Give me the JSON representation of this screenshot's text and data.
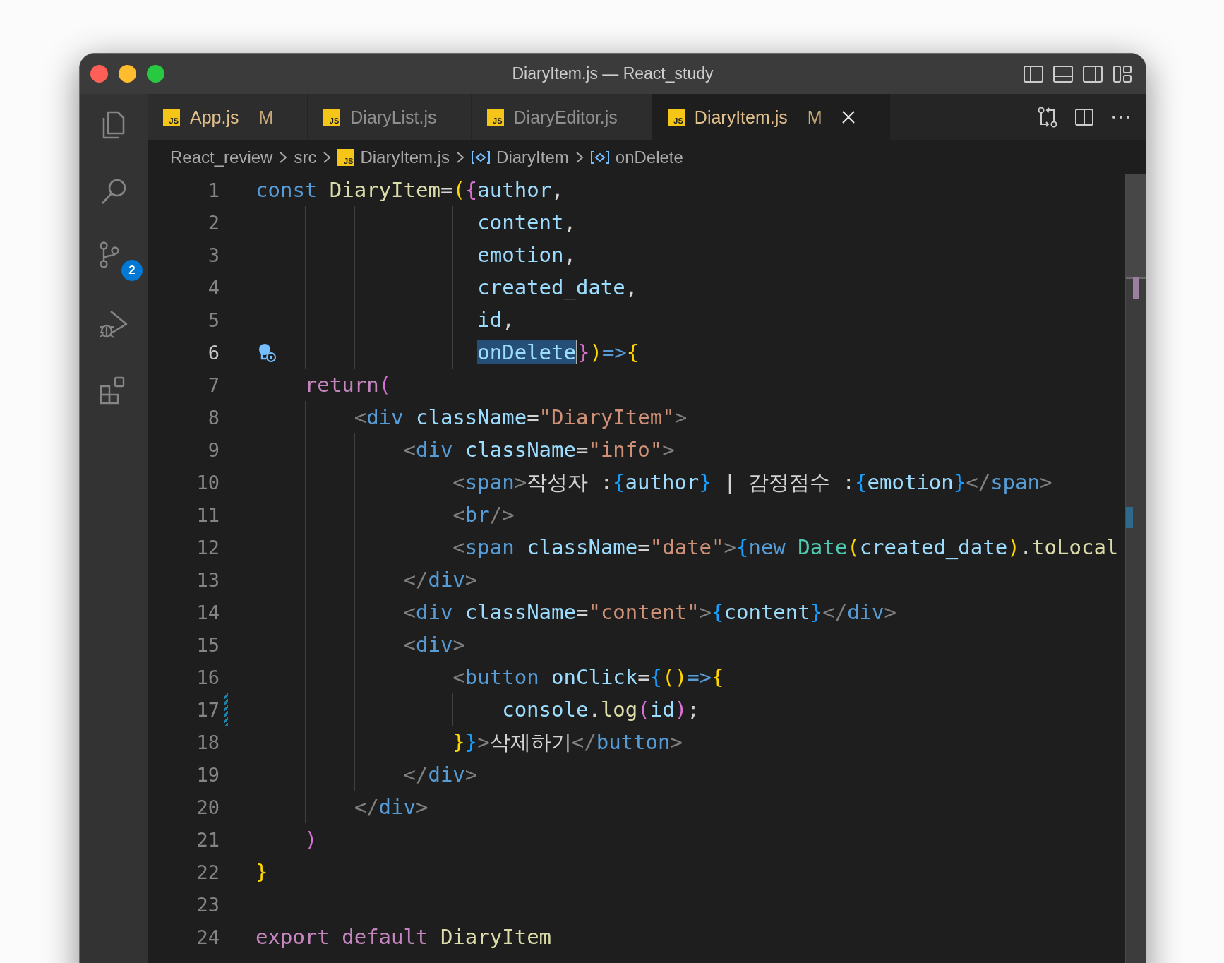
{
  "window": {
    "title": "DiaryItem.js — React_study"
  },
  "activity_bar": [
    {
      "kind": "explorer"
    },
    {
      "kind": "search"
    },
    {
      "kind": "source-control",
      "badge": "2"
    },
    {
      "kind": "run-debug"
    },
    {
      "kind": "extensions"
    }
  ],
  "tabs": [
    {
      "label": "App.js",
      "file_icon": "JS",
      "status": "M",
      "selected": false
    },
    {
      "label": "DiaryList.js",
      "file_icon": "JS",
      "selected": false
    },
    {
      "label": "DiaryEditor.js",
      "file_icon": "JS",
      "selected": false
    },
    {
      "label": "DiaryItem.js",
      "file_icon": "JS",
      "status": "M",
      "selected": true
    }
  ],
  "breadcrumb": [
    {
      "label": "React_review",
      "kind": "folder"
    },
    {
      "label": "src",
      "kind": "folder"
    },
    {
      "label": "DiaryItem.js",
      "kind": "file",
      "file_icon": "JS"
    },
    {
      "label": "DiaryItem",
      "kind": "symbol"
    },
    {
      "label": "onDelete",
      "kind": "symbol"
    }
  ],
  "lines": [
    {
      "num": "1",
      "active": false,
      "lightbulb": false,
      "modified": false,
      "tokens": [
        {
          "text": "const",
          "kind": "keyword"
        },
        {
          "text": " DiaryItem",
          "kind": "function"
        },
        {
          "text": "=",
          "kind": "punct"
        },
        {
          "text": "(",
          "kind": "bracket1"
        },
        {
          "text": "{",
          "kind": "bracket2"
        },
        {
          "text": "author",
          "kind": "variable"
        },
        {
          "text": ",",
          "kind": "punct"
        }
      ]
    },
    {
      "num": "2",
      "active": false,
      "lightbulb": false,
      "modified": false,
      "tokens": [
        {
          "text": "                  content",
          "kind": "variable"
        },
        {
          "text": ",",
          "kind": "punct"
        }
      ]
    },
    {
      "num": "3",
      "active": false,
      "lightbulb": false,
      "modified": false,
      "tokens": [
        {
          "text": "                  emotion",
          "kind": "variable"
        },
        {
          "text": ",",
          "kind": "punct"
        }
      ]
    },
    {
      "num": "4",
      "active": false,
      "lightbulb": false,
      "modified": false,
      "tokens": [
        {
          "text": "                  created_date",
          "kind": "variable"
        },
        {
          "text": ",",
          "kind": "punct"
        }
      ]
    },
    {
      "num": "5",
      "active": false,
      "lightbulb": false,
      "modified": false,
      "tokens": [
        {
          "text": "                  id",
          "kind": "variable"
        },
        {
          "text": ",",
          "kind": "punct"
        }
      ]
    },
    {
      "num": "6",
      "active": true,
      "lightbulb": true,
      "modified": false,
      "tokens": [
        {
          "text": "                  onDelete",
          "kind": "selection"
        },
        {
          "text": "}",
          "kind": "bracket2"
        },
        {
          "text": ")",
          "kind": "bracket1"
        },
        {
          "text": "=>",
          "kind": "keyword"
        },
        {
          "text": "{",
          "kind": "bracket1"
        }
      ]
    },
    {
      "num": "7",
      "active": false,
      "lightbulb": false,
      "modified": false,
      "tokens": [
        {
          "text": "    return",
          "kind": "control"
        },
        {
          "text": "(",
          "kind": "bracket2"
        }
      ]
    },
    {
      "num": "8",
      "active": false,
      "lightbulb": false,
      "modified": false,
      "tokens": [
        {
          "text": "        <",
          "kind": "angle"
        },
        {
          "text": "div",
          "kind": "tag"
        },
        {
          "text": " className",
          "kind": "attribute"
        },
        {
          "text": "=",
          "kind": "punct"
        },
        {
          "text": "\"DiaryItem\"",
          "kind": "string"
        },
        {
          "text": ">",
          "kind": "angle"
        }
      ]
    },
    {
      "num": "9",
      "active": false,
      "lightbulb": false,
      "modified": false,
      "tokens": [
        {
          "text": "            <",
          "kind": "angle"
        },
        {
          "text": "div",
          "kind": "tag"
        },
        {
          "text": " className",
          "kind": "attribute"
        },
        {
          "text": "=",
          "kind": "punct"
        },
        {
          "text": "\"info\"",
          "kind": "string"
        },
        {
          "text": ">",
          "kind": "angle"
        }
      ]
    },
    {
      "num": "10",
      "active": false,
      "lightbulb": false,
      "modified": false,
      "tokens": [
        {
          "text": "                <",
          "kind": "angle"
        },
        {
          "text": "span",
          "kind": "tag"
        },
        {
          "text": ">",
          "kind": "angle"
        },
        {
          "text": "작성자 :",
          "kind": "text"
        },
        {
          "text": "{",
          "kind": "bracket3"
        },
        {
          "text": "author",
          "kind": "variable"
        },
        {
          "text": "}",
          "kind": "bracket3"
        },
        {
          "text": " | 감정점수 :",
          "kind": "text"
        },
        {
          "text": "{",
          "kind": "bracket3"
        },
        {
          "text": "emotion",
          "kind": "variable"
        },
        {
          "text": "}",
          "kind": "bracket3"
        },
        {
          "text": "</",
          "kind": "angle"
        },
        {
          "text": "span",
          "kind": "tag"
        },
        {
          "text": ">",
          "kind": "angle"
        }
      ]
    },
    {
      "num": "11",
      "active": false,
      "lightbulb": false,
      "modified": false,
      "tokens": [
        {
          "text": "                <",
          "kind": "angle"
        },
        {
          "text": "br",
          "kind": "tag"
        },
        {
          "text": "/>",
          "kind": "angle"
        }
      ]
    },
    {
      "num": "12",
      "active": false,
      "lightbulb": false,
      "modified": false,
      "tokens": [
        {
          "text": "                <",
          "kind": "angle"
        },
        {
          "text": "span",
          "kind": "tag"
        },
        {
          "text": " className",
          "kind": "attribute"
        },
        {
          "text": "=",
          "kind": "punct"
        },
        {
          "text": "\"date\"",
          "kind": "string"
        },
        {
          "text": ">",
          "kind": "angle"
        },
        {
          "text": "{",
          "kind": "bracket3"
        },
        {
          "text": "new",
          "kind": "keyword"
        },
        {
          "text": " Date",
          "kind": "class"
        },
        {
          "text": "(",
          "kind": "bracket1"
        },
        {
          "text": "created_date",
          "kind": "variable"
        },
        {
          "text": ")",
          "kind": "bracket1"
        },
        {
          "text": ".",
          "kind": "punct"
        },
        {
          "text": "toLocal",
          "kind": "function"
        }
      ]
    },
    {
      "num": "13",
      "active": false,
      "lightbulb": false,
      "modified": false,
      "tokens": [
        {
          "text": "            </",
          "kind": "angle"
        },
        {
          "text": "div",
          "kind": "tag"
        },
        {
          "text": ">",
          "kind": "angle"
        }
      ]
    },
    {
      "num": "14",
      "active": false,
      "lightbulb": false,
      "modified": false,
      "tokens": [
        {
          "text": "            <",
          "kind": "angle"
        },
        {
          "text": "div",
          "kind": "tag"
        },
        {
          "text": " className",
          "kind": "attribute"
        },
        {
          "text": "=",
          "kind": "punct"
        },
        {
          "text": "\"content\"",
          "kind": "string"
        },
        {
          "text": ">",
          "kind": "angle"
        },
        {
          "text": "{",
          "kind": "bracket3"
        },
        {
          "text": "content",
          "kind": "variable"
        },
        {
          "text": "}",
          "kind": "bracket3"
        },
        {
          "text": "</",
          "kind": "angle"
        },
        {
          "text": "div",
          "kind": "tag"
        },
        {
          "text": ">",
          "kind": "angle"
        }
      ]
    },
    {
      "num": "15",
      "active": false,
      "lightbulb": false,
      "modified": false,
      "tokens": [
        {
          "text": "            <",
          "kind": "angle"
        },
        {
          "text": "div",
          "kind": "tag"
        },
        {
          "text": ">",
          "kind": "angle"
        }
      ]
    },
    {
      "num": "16",
      "active": false,
      "lightbulb": false,
      "modified": false,
      "tokens": [
        {
          "text": "                <",
          "kind": "angle"
        },
        {
          "text": "button",
          "kind": "tag"
        },
        {
          "text": " onClick",
          "kind": "attribute"
        },
        {
          "text": "=",
          "kind": "punct"
        },
        {
          "text": "{",
          "kind": "bracket3"
        },
        {
          "text": "()",
          "kind": "bracket1"
        },
        {
          "text": "=>",
          "kind": "keyword"
        },
        {
          "text": "{",
          "kind": "bracket1"
        }
      ]
    },
    {
      "num": "17",
      "active": false,
      "lightbulb": false,
      "modified": true,
      "tokens": [
        {
          "text": "                    console",
          "kind": "variable"
        },
        {
          "text": ".",
          "kind": "punct"
        },
        {
          "text": "log",
          "kind": "function"
        },
        {
          "text": "(",
          "kind": "bracket2"
        },
        {
          "text": "id",
          "kind": "variable"
        },
        {
          "text": ")",
          "kind": "bracket2"
        },
        {
          "text": ";",
          "kind": "punct"
        }
      ]
    },
    {
      "num": "18",
      "active": false,
      "lightbulb": false,
      "modified": false,
      "tokens": [
        {
          "text": "                }",
          "kind": "bracket1"
        },
        {
          "text": "}",
          "kind": "bracket3"
        },
        {
          "text": ">",
          "kind": "angle"
        },
        {
          "text": "삭제하기",
          "kind": "text"
        },
        {
          "text": "</",
          "kind": "angle"
        },
        {
          "text": "button",
          "kind": "tag"
        },
        {
          "text": ">",
          "kind": "angle"
        }
      ]
    },
    {
      "num": "19",
      "active": false,
      "lightbulb": false,
      "modified": false,
      "tokens": [
        {
          "text": "            </",
          "kind": "angle"
        },
        {
          "text": "div",
          "kind": "tag"
        },
        {
          "text": ">",
          "kind": "angle"
        }
      ]
    },
    {
      "num": "20",
      "active": false,
      "lightbulb": false,
      "modified": false,
      "tokens": [
        {
          "text": "        </",
          "kind": "angle"
        },
        {
          "text": "div",
          "kind": "tag"
        },
        {
          "text": ">",
          "kind": "angle"
        }
      ]
    },
    {
      "num": "21",
      "active": false,
      "lightbulb": false,
      "modified": false,
      "tokens": [
        {
          "text": "    )",
          "kind": "bracket2"
        }
      ]
    },
    {
      "num": "22",
      "active": false,
      "lightbulb": false,
      "modified": false,
      "tokens": [
        {
          "text": "}",
          "kind": "bracket1"
        }
      ]
    },
    {
      "num": "23",
      "active": false,
      "lightbulb": false,
      "modified": false
    },
    {
      "num": "24",
      "active": false,
      "lightbulb": false,
      "modified": false,
      "tokens": [
        {
          "text": "export",
          "kind": "control"
        },
        {
          "text": " default",
          "kind": "control"
        },
        {
          "text": " DiaryItem",
          "kind": "function"
        }
      ]
    }
  ]
}
